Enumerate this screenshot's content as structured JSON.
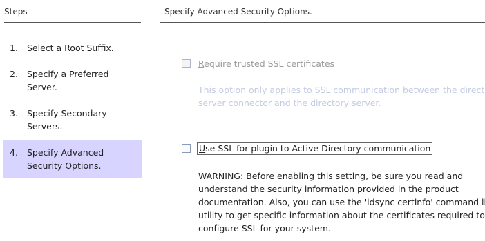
{
  "steps_panel": {
    "title": "Steps",
    "items": [
      {
        "num": "1.",
        "label": "Select a Root Suffix."
      },
      {
        "num": "2.",
        "label": "Specify a Preferred Server."
      },
      {
        "num": "3.",
        "label": "Specify Secondary Servers."
      },
      {
        "num": "4.",
        "label": "Specify Advanced Security Options.",
        "active": true
      }
    ]
  },
  "main": {
    "title": "Specify Advanced Security Options.",
    "trusted_ssl": {
      "mnemonic": "R",
      "label_rest": "equire trusted SSL certificates",
      "checked": false,
      "enabled": false,
      "note_lines": [
        "This option only applies to SSL communication between the director",
        "server connector and the directory server."
      ]
    },
    "use_ssl": {
      "mnemonic": "U",
      "label_rest": "se SSL for plugin to Active Directory communication",
      "checked": false,
      "enabled": true,
      "warning_lines": [
        "WARNING:  Before enabling this setting, be sure you read and",
        "understand the security information provided in the product",
        "documentation. Also, you can use the 'idsync certinfo' command line",
        "utility to get specific information about the certificates required to",
        "configure SSL for your system."
      ]
    }
  }
}
